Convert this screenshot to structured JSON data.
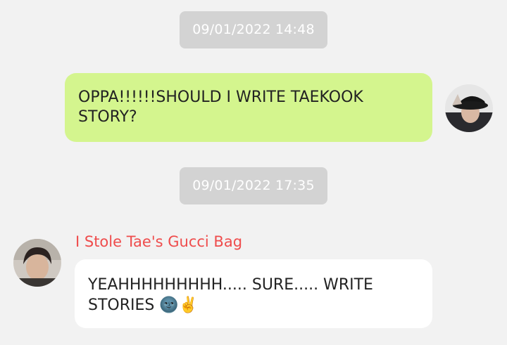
{
  "messages": [
    {
      "timestamp": "09/01/2022 14:48",
      "direction": "outgoing",
      "text": "OPPA!!!!!!SHOULD I WRITE TAEKOOK STORY?",
      "bubble_color": "#d4f58e"
    },
    {
      "timestamp": "09/01/2022 17:35",
      "direction": "incoming",
      "sender": "I Stole Tae's Gucci Bag",
      "sender_color": "#ef4c4c",
      "text": "YEAHHHHHHHHH..... SURE..... WRITE STORIES 🌚✌️",
      "bubble_color": "#ffffff"
    }
  ],
  "colors": {
    "background": "#f2f2f2",
    "timestamp_pill": "#d3d3d3"
  }
}
